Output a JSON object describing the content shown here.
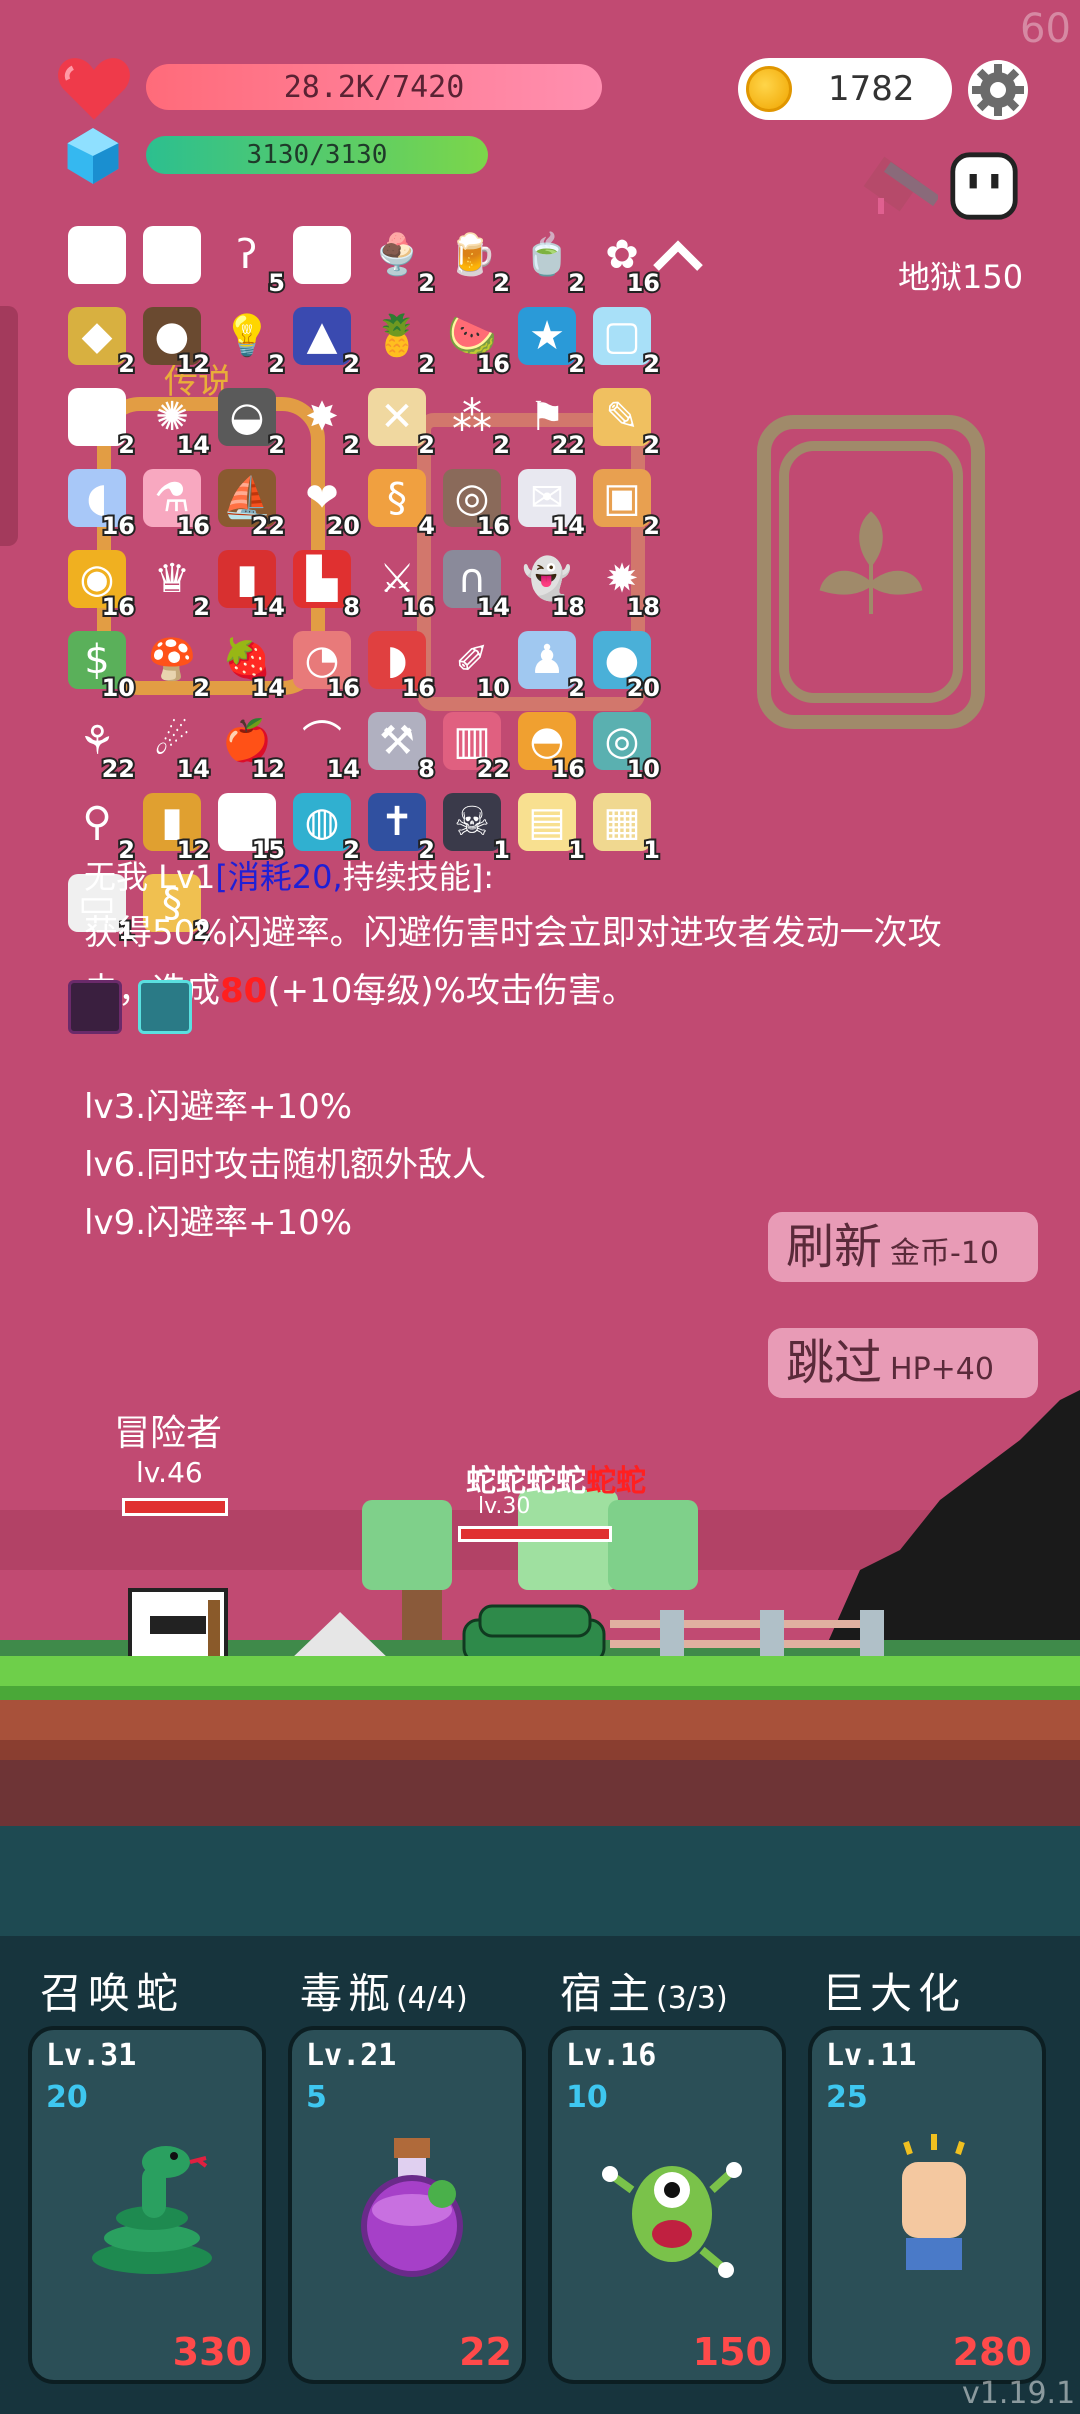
{
  "fps": "60",
  "hud": {
    "hp_text": "28.2K/7420",
    "mp_text": "3130/3130",
    "coins": "1782",
    "stage": "地狱150"
  },
  "inventory": [
    [
      {
        "icon": "envelope-card",
        "count": ""
      },
      {
        "icon": "envelope-card",
        "count": ""
      },
      {
        "icon": "hook",
        "count": "5"
      },
      {
        "icon": "envelope-card",
        "count": ""
      },
      {
        "icon": "ice-cream",
        "count": "2"
      },
      {
        "icon": "beer",
        "count": "2"
      },
      {
        "icon": "tea-cup",
        "count": "2"
      },
      {
        "icon": "flower",
        "count": "16"
      }
    ],
    [
      {
        "icon": "pineapple-shell",
        "count": "2"
      },
      {
        "icon": "coconut",
        "count": "12"
      },
      {
        "icon": "bulb",
        "count": "2"
      },
      {
        "icon": "wizard-hat",
        "count": "2"
      },
      {
        "icon": "pineapple",
        "count": "2"
      },
      {
        "icon": "watermelon",
        "count": "16"
      },
      {
        "icon": "star-card",
        "count": "2"
      },
      {
        "icon": "ice-block",
        "count": "2"
      }
    ],
    [
      {
        "icon": "playing-card",
        "count": "2"
      },
      {
        "icon": "sunflower",
        "count": "14"
      },
      {
        "icon": "mortar",
        "count": "2"
      },
      {
        "icon": "spike-ball",
        "count": "2"
      },
      {
        "icon": "treasure-map",
        "count": "2"
      },
      {
        "icon": "molecule",
        "count": "2"
      },
      {
        "icon": "flag-hill",
        "count": "22"
      },
      {
        "icon": "recipe",
        "count": "2"
      }
    ],
    [
      {
        "icon": "pill",
        "count": "16"
      },
      {
        "icon": "potion-bottle",
        "count": "16"
      },
      {
        "icon": "ship",
        "count": "22"
      },
      {
        "icon": "heart",
        "count": "20"
      },
      {
        "icon": "scroll",
        "count": "4"
      },
      {
        "icon": "shield-ring",
        "count": "16"
      },
      {
        "icon": "mail",
        "count": "14"
      },
      {
        "icon": "briefcase",
        "count": "2"
      }
    ],
    [
      {
        "icon": "coins",
        "count": "16"
      },
      {
        "icon": "crown",
        "count": "2"
      },
      {
        "icon": "red-book",
        "count": "14"
      },
      {
        "icon": "sock",
        "count": "8"
      },
      {
        "icon": "sword",
        "count": "16"
      },
      {
        "icon": "tombstone",
        "count": "14"
      },
      {
        "icon": "ghost",
        "count": "18"
      },
      {
        "icon": "mace",
        "count": "18"
      }
    ],
    [
      {
        "icon": "cash",
        "count": "10"
      },
      {
        "icon": "mushroom",
        "count": "2"
      },
      {
        "icon": "strawberry",
        "count": "14"
      },
      {
        "icon": "meat",
        "count": "16"
      },
      {
        "icon": "capsule",
        "count": "16"
      },
      {
        "icon": "syringe",
        "count": "10"
      },
      {
        "icon": "robe",
        "count": "2"
      },
      {
        "icon": "bomb-potion",
        "count": "20"
      }
    ],
    [
      {
        "icon": "tulip",
        "count": "22"
      },
      {
        "icon": "flail",
        "count": "14"
      },
      {
        "icon": "apple",
        "count": "12"
      },
      {
        "icon": "rainbow",
        "count": "14"
      },
      {
        "icon": "double-axe",
        "count": "8"
      },
      {
        "icon": "jam-jar",
        "count": "22"
      },
      {
        "icon": "bread",
        "count": "16"
      },
      {
        "icon": "donut",
        "count": "10"
      }
    ],
    [
      {
        "icon": "safety-pin",
        "count": "2"
      },
      {
        "icon": "golden-book",
        "count": "12"
      },
      {
        "icon": "dice",
        "count": "15"
      },
      {
        "icon": "spiral-tile",
        "count": "2"
      },
      {
        "icon": "bible",
        "count": "2"
      },
      {
        "icon": "skull-book",
        "count": "1"
      },
      {
        "icon": "map",
        "count": "1"
      },
      {
        "icon": "world-map",
        "count": "1"
      }
    ],
    [
      {
        "icon": "open-book",
        "count": "1"
      },
      {
        "icon": "golden-scroll",
        "count": "2"
      }
    ]
  ],
  "overlay_tag": "传说",
  "skill": {
    "name_prefix": "无我 Lv1",
    "cost_label": "[消耗20,",
    "cost_suffix": "持续技能]:",
    "desc_part1": "获得50%闪避率。闪避伤害时会立即对进攻者发动一次攻击，造成",
    "desc_num": "80",
    "desc_part2": "(+10每级)%攻击伤害。",
    "levels": [
      "lv3.闪避率+10%",
      "lv6.同时攻击随机额外敌人",
      "lv9.闪避率+10%"
    ]
  },
  "buttons": {
    "refresh_main": "刷新",
    "refresh_sub": "金币-10",
    "skip_main": "跳过",
    "skip_sub": "HP+40"
  },
  "battle": {
    "hero_name": "冒险者",
    "hero_level": "lv.46",
    "enemy_name_white": "蛇蛇蛇蛇",
    "enemy_name_red": "蛇蛇",
    "enemy_level": "lv.30"
  },
  "skill_cards": [
    {
      "title": "召唤蛇",
      "charges": "",
      "level": "Lv.31",
      "cost": "20",
      "price": "330",
      "icon": "snake"
    },
    {
      "title": "毒瓶",
      "charges": "(4/4)",
      "level": "Lv.21",
      "cost": "5",
      "price": "22",
      "icon": "poison-flask"
    },
    {
      "title": "宿主",
      "charges": "(3/3)",
      "level": "Lv.16",
      "cost": "10",
      "price": "150",
      "icon": "parasite-monster"
    },
    {
      "title": "巨大化",
      "charges": "",
      "level": "Lv.11",
      "cost": "25",
      "price": "280",
      "icon": "fist"
    }
  ],
  "version": "v1.19.1",
  "colors": {
    "background": "#c14a72",
    "hp_bar": "#ff6b7a",
    "mp_bar": "#2cbf8f",
    "accent_red": "#ff1f1f",
    "skill_cost_blue": "#3ec7f0",
    "card_bg": "#2b4f57"
  }
}
